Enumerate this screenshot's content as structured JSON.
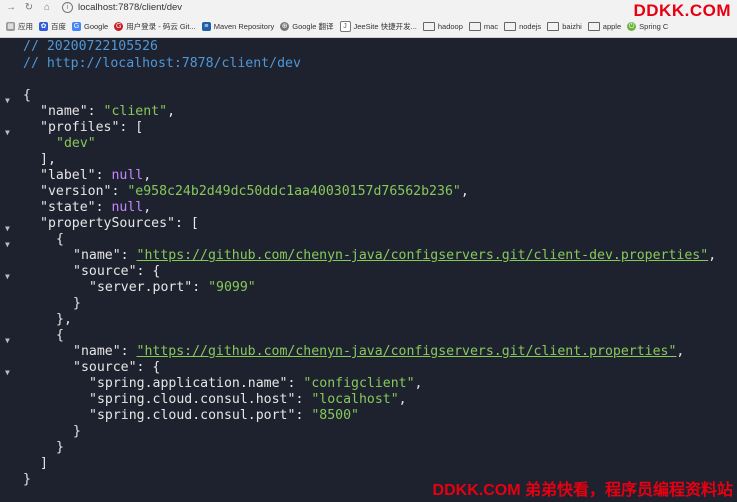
{
  "browser": {
    "url": "localhost:7878/client/dev",
    "back_icon": "back-arrow",
    "forward_icon": "forward-arrow",
    "home_icon": "home"
  },
  "watermark_top": "DDKK.COM",
  "bookmarks": [
    {
      "label": "应用",
      "icon": "apps",
      "color": "#999999"
    },
    {
      "label": "百度",
      "icon": "baidu",
      "color": "#2f5bd8"
    },
    {
      "label": "Google",
      "icon": "google",
      "color": "#4285f4"
    },
    {
      "label": "用户登录 - 码云 Git...",
      "icon": "gitee",
      "color": "#c71d23"
    },
    {
      "label": "Maven Repository",
      "icon": "maven",
      "color": "#1f5fa8"
    },
    {
      "label": "Google 翻译",
      "icon": "translate",
      "color": "#777777"
    },
    {
      "label": "JeeSite 快捷开发...",
      "icon": "doc",
      "color": "#777777"
    },
    {
      "label": "hadoop",
      "icon": "folder"
    },
    {
      "label": "mac",
      "icon": "folder"
    },
    {
      "label": "nodejs",
      "icon": "folder"
    },
    {
      "label": "baizhi",
      "icon": "folder"
    },
    {
      "label": "apple",
      "icon": "folder"
    },
    {
      "label": "Spring C",
      "icon": "spring",
      "color": "#6db33f"
    }
  ],
  "json_view": {
    "comment_time": "// 20200722105526",
    "comment_url": "// http://localhost:7878/client/dev",
    "name_key": "\"name\"",
    "name_value": "\"client\"",
    "profiles_key": "\"profiles\"",
    "profile_0": "\"dev\"",
    "label_key": "\"label\"",
    "label_value": "null",
    "version_key": "\"version\"",
    "version_value": "\"e958c24b2d49dc50ddc1aa40030157d76562b236\"",
    "state_key": "\"state\"",
    "state_value": "null",
    "propertySources_key": "\"propertySources\"",
    "ps0_name_value": "\"https://github.com/chenyn-java/configservers.git/client-dev.properties\"",
    "source_key": "\"source\"",
    "ps0_server_port_key": "\"server.port\"",
    "ps0_server_port_value": "\"9099\"",
    "ps1_name_value": "\"https://github.com/chenyn-java/configservers.git/client.properties\"",
    "ps1_app_name_key": "\"spring.application.name\"",
    "ps1_app_name_value": "\"configclient\"",
    "ps1_consul_host_key": "\"spring.cloud.consul.host\"",
    "ps1_consul_host_value": "\"localhost\"",
    "ps1_consul_port_key": "\"spring.cloud.consul.port\"",
    "ps1_consul_port_value": "\"8500\""
  },
  "colors": {
    "background": "#1e222e",
    "comment": "#4f97d7",
    "string": "#86c95b",
    "null": "#c586ff",
    "watermark": "#e60012"
  },
  "watermark_bottom": "DDKK.COM 弟弟快看，程序员编程资料站"
}
